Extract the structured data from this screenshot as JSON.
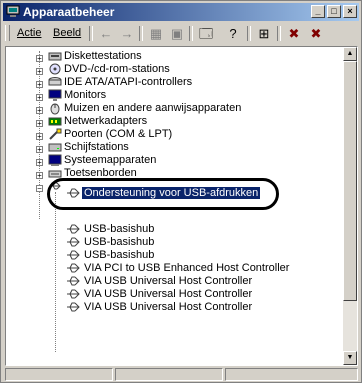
{
  "window": {
    "title": "Apparaatbeheer",
    "icon": "computer-management-icon",
    "buttons": [
      "minimize",
      "maximize",
      "close"
    ]
  },
  "menu": {
    "items": [
      {
        "label": "Actie",
        "underline": "A"
      },
      {
        "label": "Beeld",
        "underline": "B"
      }
    ]
  },
  "toolbar": {
    "icons": [
      "back-arrow-icon",
      "forward-arrow-icon",
      "properties-icon",
      "view-icon",
      "device-props-icon",
      "help-icon",
      "scan-icon",
      "remove-icon",
      "disable-icon"
    ]
  },
  "tree": {
    "categories": [
      {
        "label": "Diskettestations",
        "icon": "floppy-drive-icon"
      },
      {
        "label": "DVD-/cd-rom-stations",
        "icon": "dvd-drive-icon"
      },
      {
        "label": "IDE ATA/ATAPI-controllers",
        "icon": "ide-controller-icon"
      },
      {
        "label": "Monitors",
        "icon": "monitor-icon"
      },
      {
        "label": "Muizen en andere aanwijsapparaten",
        "icon": "mouse-icon"
      },
      {
        "label": "Netwerkadapters",
        "icon": "network-adapter-icon"
      },
      {
        "label": "Poorten (COM & LPT)",
        "icon": "port-icon"
      },
      {
        "label": "Schijfstations",
        "icon": "disk-drive-icon"
      },
      {
        "label": "Systeemapparaten",
        "icon": "system-device-icon"
      },
      {
        "label": "Toetsenborden",
        "icon": "keyboard-icon"
      }
    ],
    "usb_children": [
      {
        "label": "Ondersteuning voor USB-afdrukken",
        "selected": true
      },
      {
        "label": "USB-basishub"
      },
      {
        "label": "USB-basishub"
      },
      {
        "label": "USB-basishub"
      },
      {
        "label": "VIA PCI to USB Enhanced Host Controller"
      },
      {
        "label": "VIA USB Universal Host Controller"
      },
      {
        "label": "VIA USB Universal Host Controller"
      },
      {
        "label": "VIA USB Universal Host Controller"
      }
    ]
  },
  "colors": {
    "title_start": "#0a246a",
    "title_end": "#a6caf0",
    "selection": "#0a246a",
    "face": "#d4d0c8"
  }
}
